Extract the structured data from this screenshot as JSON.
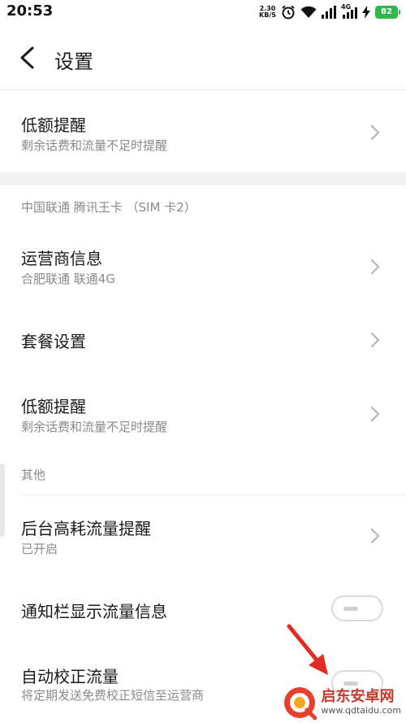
{
  "status_bar": {
    "time": "20:53",
    "net_speed_value": "2.30",
    "net_speed_unit": "KB/S",
    "network_type": "4G",
    "battery_level": "82",
    "battery_color": "#2fb84a"
  },
  "header": {
    "title": "设置"
  },
  "rows": {
    "low_balance_1": {
      "title": "低额提醒",
      "subtitle": "剩余话费和流量不足时提醒"
    },
    "sim2_section": "中国联通 腾讯王卡 （SIM 卡2）",
    "carrier_info": {
      "title": "运营商信息",
      "subtitle": "合肥联通 联通4G"
    },
    "plan_settings": {
      "title": "套餐设置"
    },
    "low_balance_2": {
      "title": "低额提醒",
      "subtitle": "剩余话费和流量不足时提醒"
    },
    "other_section": "其他",
    "background_usage": {
      "title": "后台高耗流量提醒",
      "subtitle": "已开启"
    },
    "notification_traffic": {
      "title": "通知栏显示流量信息",
      "toggle_state": "off"
    },
    "auto_calibrate": {
      "title": "自动校正流量",
      "subtitle": "将定期发送免费校正短信至运营商",
      "toggle_state": "off"
    }
  },
  "overlay": {
    "annotation": "red-arrow-pointing-to-toggle",
    "annotation_color": "#e32b25"
  },
  "watermark": {
    "name": "启东安卓网",
    "url": "www.qdtaidu.com"
  },
  "icons": {
    "back": "back-arrow-icon",
    "chevron": "chevron-right-icon",
    "wifi": "wifi-icon",
    "signal": "signal-icon",
    "alarm": "alarm-icon",
    "charging": "charging-icon"
  }
}
